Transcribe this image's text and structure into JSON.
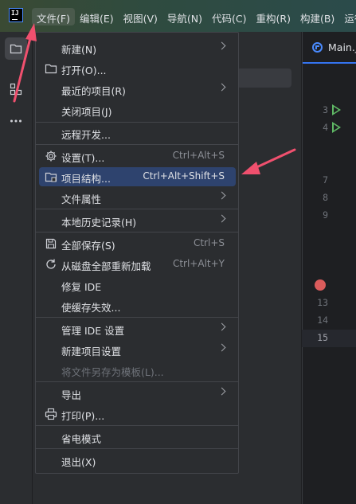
{
  "menubar": {
    "logo_text": "IJ",
    "items": [
      "文件(F)",
      "编辑(E)",
      "视图(V)",
      "导航(N)",
      "代码(C)",
      "重构(R)",
      "构建(B)",
      "运行"
    ]
  },
  "editor": {
    "tab_label": "Main.j",
    "line_numbers": [
      "3",
      "4",
      "7",
      "8",
      "9",
      "13",
      "14",
      "15"
    ]
  },
  "file_menu": {
    "new": "新建(N)",
    "open": "打开(O)...",
    "recent": "最近的项目(R)",
    "close": "关闭项目(J)",
    "remote": "远程开发...",
    "settings": "设置(T)...",
    "settings_sc": "Ctrl+Alt+S",
    "project_structure": "项目结构...",
    "project_structure_sc": "Ctrl+Alt+Shift+S",
    "file_props": "文件属性",
    "local_history": "本地历史记录(H)",
    "save_all": "全部保存(S)",
    "save_all_sc": "Ctrl+S",
    "reload": "从磁盘全部重新加载",
    "reload_sc": "Ctrl+Alt+Y",
    "repair": "修复 IDE",
    "invalidate": "使缓存失效...",
    "manage_ide": "管理 IDE 设置",
    "new_project_settings": "新建项目设置",
    "save_as_template": "将文件另存为模板(L)...",
    "export": "导出",
    "print": "打印(P)...",
    "power_save": "省电模式",
    "exit": "退出(X)"
  },
  "colors": {
    "accent": "#3574f0",
    "highlight": "#2e436e",
    "annotation_arrow": "#f0506e",
    "run_green": "#5fb865",
    "breakpoint_red": "#db5c5c"
  }
}
